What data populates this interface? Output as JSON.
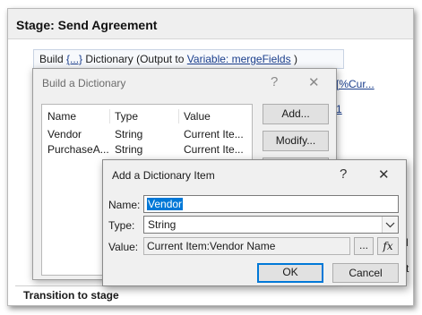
{
  "stage": {
    "title": "Stage: Send Agreement",
    "action": {
      "prefix": "Build ",
      "link1": "{...}",
      "mid": " Dictionary (Output to ",
      "link2": "Variable: mergeFields",
      "suffix": " )"
    },
    "bg_fragments": {
      "link_right": "[%Cur...",
      "link_one": "1",
      "frag_d": "d",
      "frag_st": "st"
    },
    "transition_label": "Transition to stage"
  },
  "build_dialog": {
    "title": "Build a Dictionary",
    "help_glyph": "?",
    "close_glyph": "✕",
    "columns": [
      "Name",
      "Type",
      "Value"
    ],
    "rows": [
      {
        "name": "Vendor",
        "type": "String",
        "value": "Current Ite..."
      },
      {
        "name": "PurchaseA...",
        "type": "String",
        "value": "Current Ite..."
      }
    ],
    "buttons": {
      "add": "Add...",
      "modify": "Modify..."
    }
  },
  "add_dialog": {
    "title": "Add a Dictionary Item",
    "help_glyph": "?",
    "close_glyph": "✕",
    "name_label": "Name:",
    "name_value": "Vendor",
    "type_label": "Type:",
    "type_value": "String",
    "value_label": "Value:",
    "value_value": "Current Item:Vendor Name",
    "browse_button": "...",
    "fx_button": "fx",
    "ok_button": "OK",
    "cancel_button": "Cancel"
  },
  "colors": {
    "selection": "#0078d7",
    "link": "#1a3e8c",
    "dialog_bg": "#f0f0f0"
  }
}
